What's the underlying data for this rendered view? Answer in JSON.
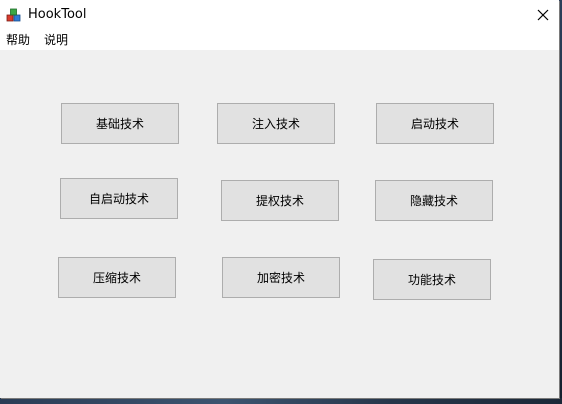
{
  "window": {
    "title": "HookTool",
    "app_icon": "colored-cubes-icon",
    "close_icon": "close-icon"
  },
  "menu": {
    "items": [
      {
        "label": "帮助"
      },
      {
        "label": "说明"
      }
    ]
  },
  "buttons": [
    {
      "label": "基础技术"
    },
    {
      "label": "注入技术"
    },
    {
      "label": "启动技术"
    },
    {
      "label": "自启动技术"
    },
    {
      "label": "提权技术"
    },
    {
      "label": "隐藏技术"
    },
    {
      "label": "压缩技术"
    },
    {
      "label": "加密技术"
    },
    {
      "label": "功能技术"
    }
  ],
  "colors": {
    "titlebar": "#ffffff",
    "client_bg": "#f0f0f0",
    "button_bg": "#e1e1e1",
    "button_border": "#adadad"
  }
}
